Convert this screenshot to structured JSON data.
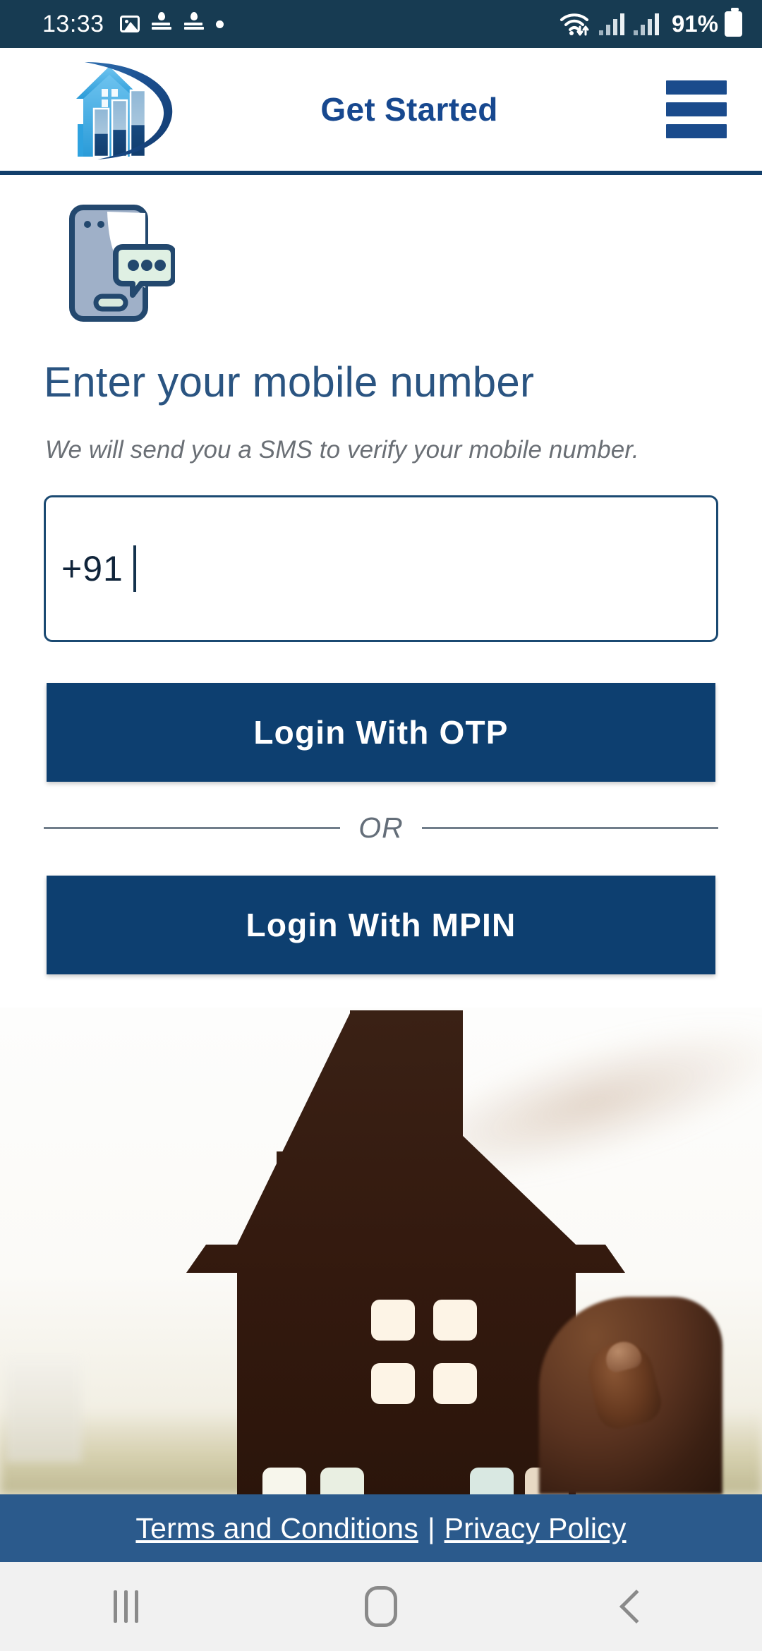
{
  "status_bar": {
    "time": "13:33",
    "battery_percent": "91%",
    "left_icons": [
      "image-icon",
      "dainik-bhaskar-icon",
      "dainik-bhaskar-icon",
      "dot-icon"
    ],
    "right_icons": [
      "wifi-icon",
      "signal-icon",
      "signal-icon",
      "battery-icon"
    ],
    "background_color": "#173b52"
  },
  "header": {
    "title": "Get Started",
    "logo_name": "house-growth-chart-logo",
    "menu_icon": "hamburger-menu-icon",
    "title_color": "#17488f",
    "divider_color": "#123f6b"
  },
  "main": {
    "illustration": "phone-sms-message-icon",
    "heading": "Enter your mobile number",
    "subheading": "We will send you a SMS to verify your mobile number.",
    "phone_input": {
      "value": "+91",
      "placeholder": "+91",
      "border_color": "#1b4a72"
    },
    "primary_button": "Login With OTP",
    "divider_label": "OR",
    "secondary_button": "Login With MPIN",
    "button_color": "#0d3f70",
    "hero_image": "house-cutout-held-in-hand-photo"
  },
  "footer": {
    "terms_link": "Terms and Conditions",
    "separator": "|",
    "privacy_link": "Privacy Policy",
    "background_color": "#2b5a8c"
  },
  "navigation_bar": {
    "recents": "recents-icon",
    "home": "home-icon",
    "back": "back-icon",
    "background_color": "#f1f1f1"
  }
}
